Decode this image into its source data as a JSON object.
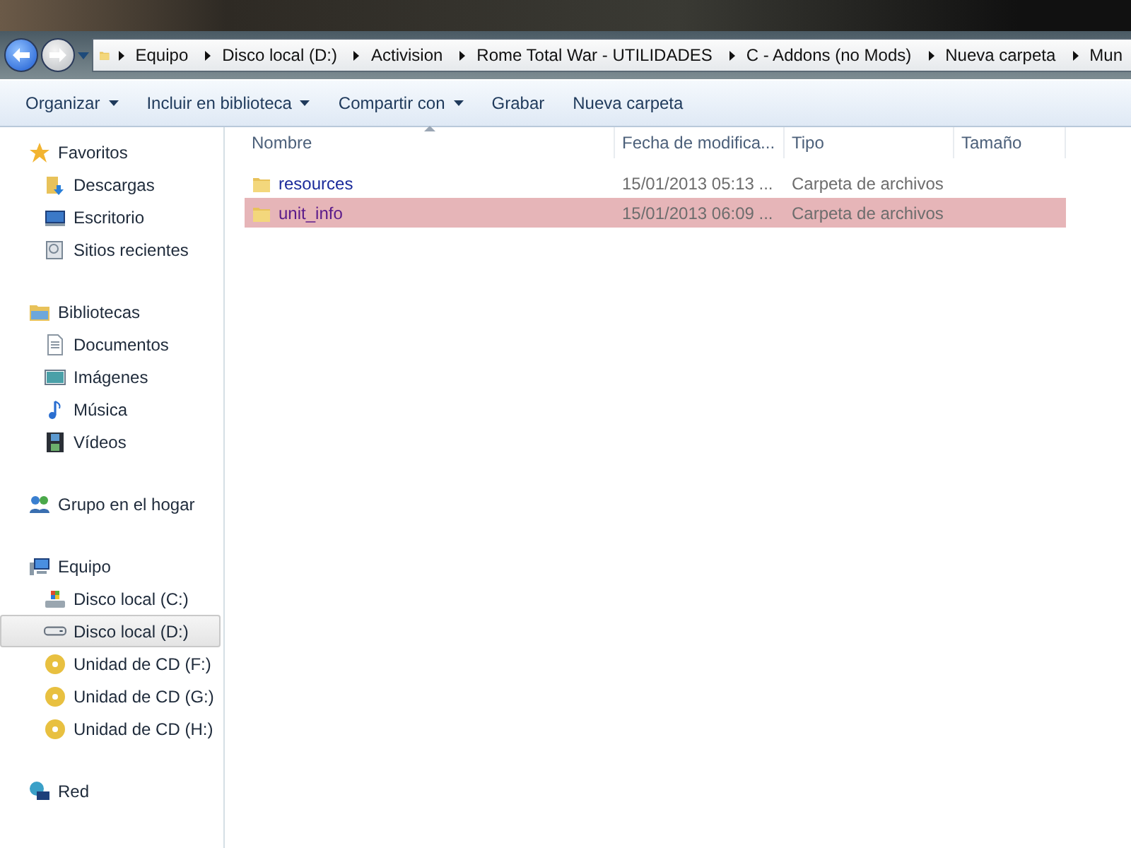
{
  "breadcrumb": [
    "Equipo",
    "Disco local (D:)",
    "Activision",
    "Rome Total War - UTILIDADES",
    "C - Addons (no Mods)",
    "Nueva carpeta",
    "Mun"
  ],
  "toolbar": [
    {
      "label": "Organizar",
      "dropdown": true
    },
    {
      "label": "Incluir en biblioteca",
      "dropdown": true
    },
    {
      "label": "Compartir con",
      "dropdown": true
    },
    {
      "label": "Grabar",
      "dropdown": false
    },
    {
      "label": "Nueva carpeta",
      "dropdown": false
    }
  ],
  "sidebar": [
    {
      "label": "Favoritos",
      "kind": "star",
      "children": [
        {
          "label": "Descargas",
          "kind": "downloads",
          "selected": false
        },
        {
          "label": "Escritorio",
          "kind": "desktop",
          "selected": false
        },
        {
          "label": "Sitios recientes",
          "kind": "recent",
          "selected": false
        }
      ]
    },
    {
      "label": "Bibliotecas",
      "kind": "library",
      "children": [
        {
          "label": "Documentos",
          "kind": "document",
          "selected": false
        },
        {
          "label": "Imágenes",
          "kind": "image",
          "selected": false
        },
        {
          "label": "Música",
          "kind": "music",
          "selected": false
        },
        {
          "label": "Vídeos",
          "kind": "video",
          "selected": false
        }
      ]
    },
    {
      "label": "Grupo en el hogar",
      "kind": "homegroup"
    },
    {
      "label": "Equipo",
      "kind": "computer",
      "children": [
        {
          "label": "Disco local (C:)",
          "kind": "sysdrive",
          "selected": false
        },
        {
          "label": "Disco local (D:)",
          "kind": "drive",
          "selected": true
        },
        {
          "label": "Unidad de CD (F:)",
          "kind": "cd",
          "selected": false
        },
        {
          "label": "Unidad de CD (G:)",
          "kind": "cd",
          "selected": false
        },
        {
          "label": "Unidad de CD (H:)",
          "kind": "cd",
          "selected": false
        }
      ]
    },
    {
      "label": "Red",
      "kind": "network"
    }
  ],
  "table": {
    "columns": [
      {
        "label": "Nombre",
        "sorted": true
      },
      {
        "label": "Fecha de modifica...",
        "sorted": false
      },
      {
        "label": "Tipo",
        "sorted": false
      },
      {
        "label": "Tamaño",
        "sorted": false
      }
    ],
    "rows": [
      {
        "name": "resources",
        "date": "15/01/2013 05:13 ...",
        "type": "Carpeta de archivos",
        "selected": false
      },
      {
        "name": "unit_info",
        "date": "15/01/2013 06:09 ...",
        "type": "Carpeta de archivos",
        "selected": true
      }
    ]
  }
}
